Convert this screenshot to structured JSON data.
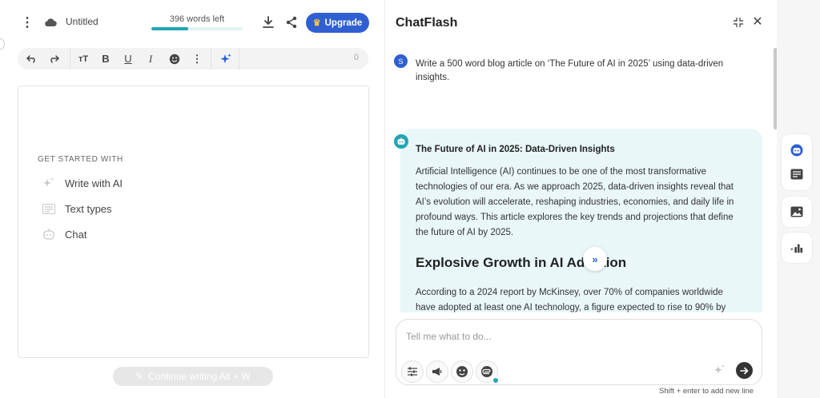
{
  "editor": {
    "menu_icon": "kebab-menu-icon",
    "cloud_icon": "cloud-icon",
    "title": "Untitled",
    "words_left_label": "396 words left",
    "words_progress": 0.4,
    "download_icon": "download-icon",
    "share_icon": "share-icon",
    "upgrade_label": "Upgrade",
    "toolbar": {
      "items": [
        "undo-icon",
        "redo-icon",
        "text-size-icon",
        "bold-icon",
        "underline-icon",
        "italic-icon",
        "emoji-icon",
        "more-icon",
        "ai-sparkle-icon"
      ],
      "bold": "B",
      "underline": "U",
      "italic": "I",
      "count": "0"
    },
    "get_started": {
      "title": "GET STARTED WITH",
      "items": [
        {
          "label": "Write with AI",
          "icon": "sparkle-icon"
        },
        {
          "label": "Text types",
          "icon": "text-types-icon"
        },
        {
          "label": "Chat",
          "icon": "chat-bot-icon"
        }
      ]
    },
    "continue_label": "Continue writing Alt + W"
  },
  "chat": {
    "title": "ChatFlash",
    "user_initial": "S",
    "user_message": "Write a 500 word blog article on ‘The Future of AI in 2025’ using data-driven insights.",
    "bot": {
      "heading": "The Future of AI in 2025: Data-Driven Insights",
      "paragraph": "Artificial Intelligence (AI) continues to be one of the most transformative technologies of our era. As we approach 2025, data-driven insights reveal that AI’s evolution will accelerate, reshaping industries, economies, and daily life in profound ways. This article explores the key trends and projections that define the future of AI by 2025.",
      "subheading": "Explosive Growth in AI Adoption",
      "paragraph2": "According to a 2024 report by McKinsey, over 70% of companies worldwide have adopted at least one AI technology, a figure expected to rise to 90% by"
    },
    "input_placeholder": "Tell me what to do...",
    "hint": "Shift + enter to add new line"
  },
  "colors": {
    "accent": "#2f5fd0",
    "teal": "#22a6b3",
    "bubble": "#e9f7f8"
  }
}
